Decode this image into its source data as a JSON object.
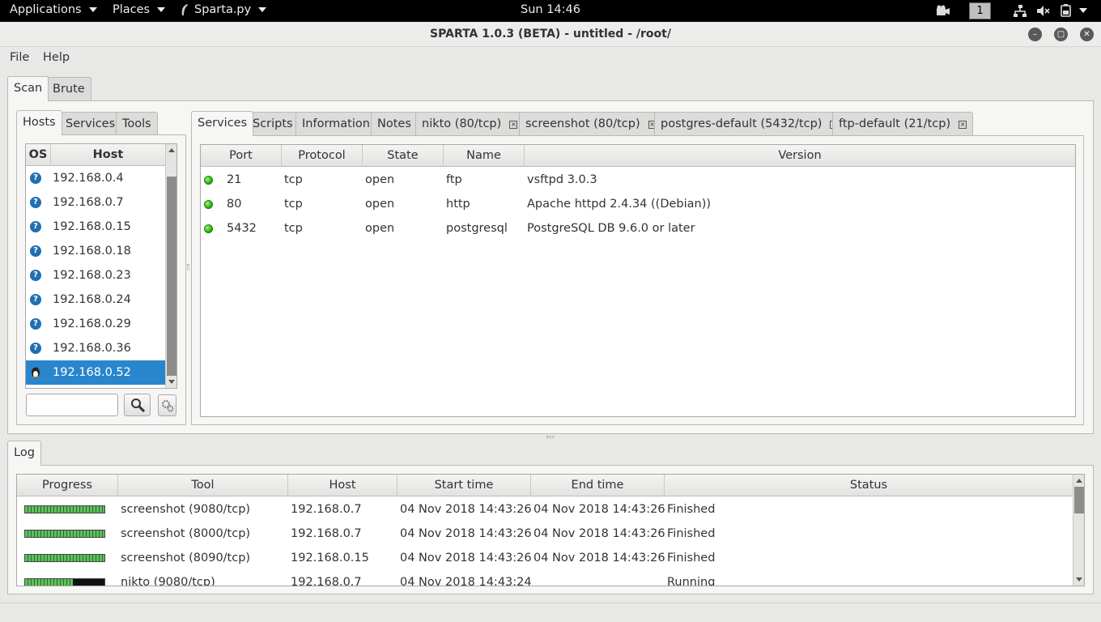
{
  "topbar": {
    "applications": "Applications",
    "places": "Places",
    "app_menu": "Sparta.py",
    "clock": "Sun 14:46",
    "workspace": "1"
  },
  "window": {
    "title": "SPARTA 1.0.3 (BETA) - untitled - /root/"
  },
  "menu": {
    "file": "File",
    "help": "Help"
  },
  "main_tabs": [
    "Scan",
    "Brute"
  ],
  "left_tabs": [
    "Hosts",
    "Services",
    "Tools"
  ],
  "hosts_table": {
    "columns": [
      "OS",
      "Host"
    ],
    "rows": [
      {
        "os_icon": "question-icon",
        "host": "192.168.0.4"
      },
      {
        "os_icon": "question-icon",
        "host": "192.168.0.7"
      },
      {
        "os_icon": "question-icon",
        "host": "192.168.0.15"
      },
      {
        "os_icon": "question-icon",
        "host": "192.168.0.18"
      },
      {
        "os_icon": "question-icon",
        "host": "192.168.0.23"
      },
      {
        "os_icon": "question-icon",
        "host": "192.168.0.24"
      },
      {
        "os_icon": "question-icon",
        "host": "192.168.0.29"
      },
      {
        "os_icon": "question-icon",
        "host": "192.168.0.36"
      },
      {
        "os_icon": "linux-icon",
        "host": "192.168.0.52",
        "selected": true
      }
    ],
    "filter_value": ""
  },
  "right_tabs": [
    {
      "label": "Services",
      "closable": false
    },
    {
      "label": "Scripts",
      "closable": false
    },
    {
      "label": "Information",
      "closable": false
    },
    {
      "label": "Notes",
      "closable": false
    },
    {
      "label": "nikto (80/tcp)",
      "closable": true
    },
    {
      "label": "screenshot (80/tcp)",
      "closable": true
    },
    {
      "label": "postgres-default (5432/tcp)",
      "closable": true
    },
    {
      "label": "ftp-default (21/tcp)",
      "closable": true
    }
  ],
  "services_table": {
    "columns": [
      "Port",
      "Protocol",
      "State",
      "Name",
      "Version"
    ],
    "rows": [
      {
        "port": "21",
        "protocol": "tcp",
        "state": "open",
        "name": "ftp",
        "version": "vsftpd 3.0.3"
      },
      {
        "port": "80",
        "protocol": "tcp",
        "state": "open",
        "name": "http",
        "version": "Apache httpd 2.4.34 ((Debian))"
      },
      {
        "port": "5432",
        "protocol": "tcp",
        "state": "open",
        "name": "postgresql",
        "version": "PostgreSQL DB 9.6.0 or later"
      }
    ]
  },
  "log": {
    "tab": "Log",
    "columns": [
      "Progress",
      "Tool",
      "Host",
      "Start time",
      "End time",
      "Status"
    ],
    "rows": [
      {
        "progress": 1.0,
        "tool": "screenshot (9080/tcp)",
        "host": "192.168.0.7",
        "start": "04 Nov 2018 14:43:26",
        "end": "04 Nov 2018 14:43:26",
        "status": "Finished"
      },
      {
        "progress": 1.0,
        "tool": "screenshot (8000/tcp)",
        "host": "192.168.0.7",
        "start": "04 Nov 2018 14:43:26",
        "end": "04 Nov 2018 14:43:26",
        "status": "Finished"
      },
      {
        "progress": 1.0,
        "tool": "screenshot (8090/tcp)",
        "host": "192.168.0.15",
        "start": "04 Nov 2018 14:43:26",
        "end": "04 Nov 2018 14:43:26",
        "status": "Finished"
      },
      {
        "progress": 0.6,
        "tool": "nikto (9080/tcp)",
        "host": "192.168.0.7",
        "start": "04 Nov 2018 14:43:24",
        "end": "",
        "status": "Running"
      }
    ]
  },
  "colors": {
    "selection": "#2a86cc",
    "topbar": "#000000",
    "open_dot": "#16a800"
  }
}
